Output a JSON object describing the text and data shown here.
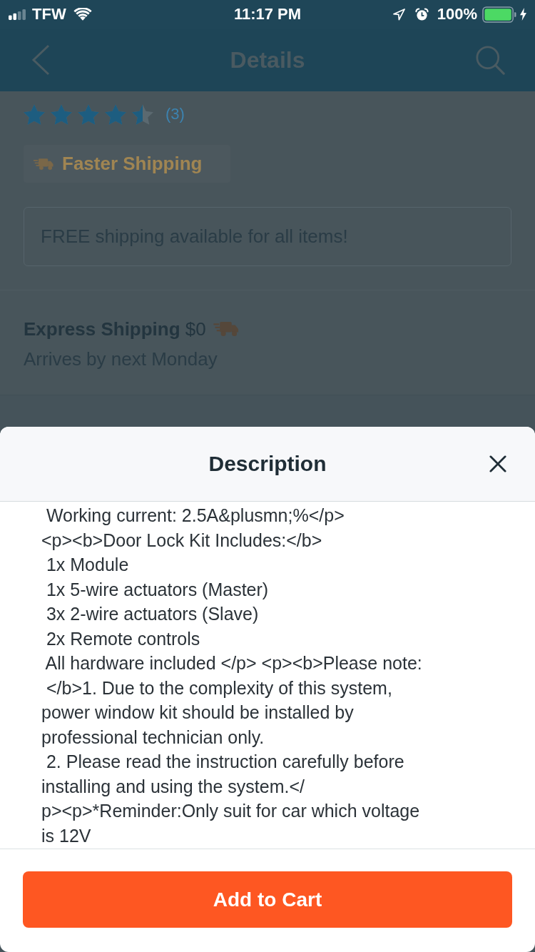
{
  "status_bar": {
    "carrier": "TFW",
    "time": "11:17 PM",
    "battery": "100%"
  },
  "nav_bar": {
    "title": "Details"
  },
  "product": {
    "rating": {
      "stars": 4.5,
      "count": "(3)"
    },
    "badge": {
      "label": "Faster Shipping"
    },
    "shipping_notice": "FREE shipping available for all items!",
    "shipping_option": {
      "title": "**Express Shipping** $0",
      "eta": "Arrives by next Monday"
    }
  },
  "description_sheet": {
    "title": "Description",
    "lines": [
      " Working current: 2.5A&plusmn;%</p>",
      "<p><b>Door Lock Kit Includes:</b>",
      " 1x Module",
      " 1x 5-wire actuators (Master)",
      " 3x 2-wire actuators (Slave)",
      " 2x Remote controls",
      " All hardware included </p> <p><b>Please note:",
      " </b>1. Due to the complexity of this system,",
      "power window kit should be installed by",
      "professional technician only.",
      " 2. Please read the instruction carefully before",
      "installing and using the system.</",
      "p><p>*Reminder:Only suit for car which voltage",
      "is 12V"
    ]
  },
  "add_to_cart": {
    "label": "Add to Cart"
  }
}
